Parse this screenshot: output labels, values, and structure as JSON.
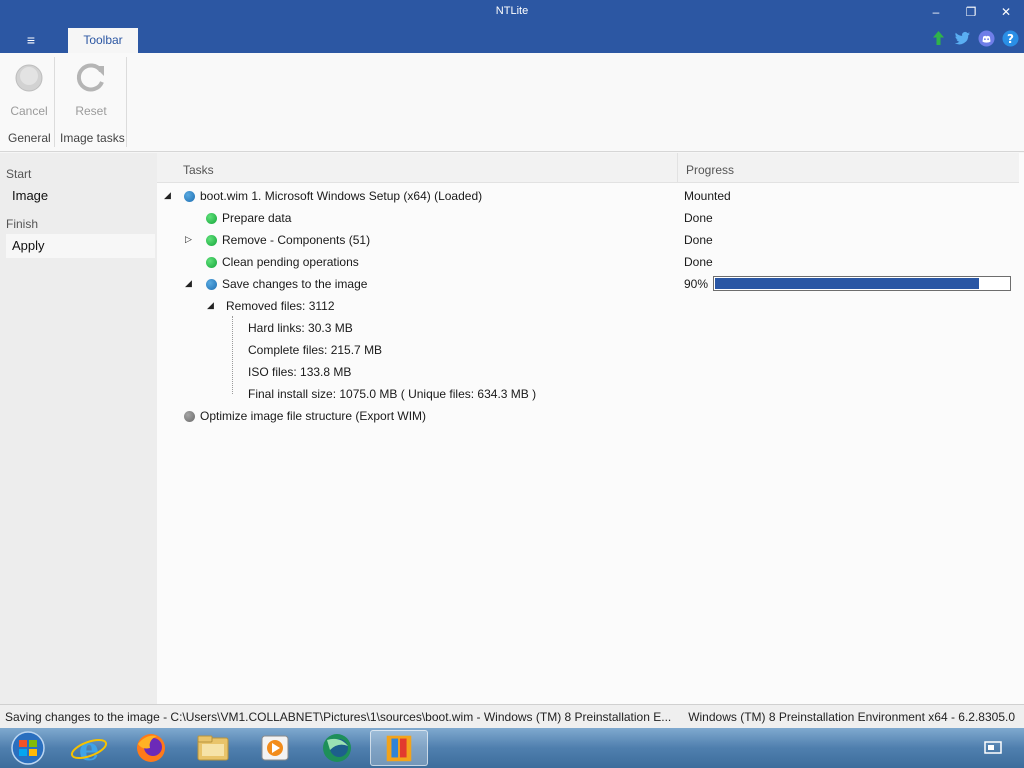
{
  "window": {
    "title": "NTLite",
    "minimize_glyph": "–",
    "restore_glyph": "❐",
    "close_glyph": "✕"
  },
  "menu": {
    "hamburger_glyph": "≡"
  },
  "ribbon": {
    "tab_label": "Toolbar",
    "buttons": {
      "cancel": "Cancel",
      "reset": "Reset"
    },
    "groups": {
      "general": "General",
      "image_tasks": "Image tasks"
    }
  },
  "social_icons": [
    "update-arrow-icon",
    "twitter-icon",
    "discord-icon",
    "help-icon"
  ],
  "nav": {
    "start_header": "Start",
    "image_item": "Image",
    "finish_header": "Finish",
    "apply_item": "Apply"
  },
  "columns": {
    "tasks": "Tasks",
    "progress": "Progress"
  },
  "tasks": {
    "image": {
      "label": "boot.wim 1. Microsoft Windows Setup (x64)  (Loaded)",
      "status": "Mounted"
    },
    "prepare": {
      "label": "Prepare data",
      "status": "Done"
    },
    "remove": {
      "label": "Remove - Components (51)",
      "status": "Done"
    },
    "clean": {
      "label": "Clean pending operations",
      "status": "Done"
    },
    "save": {
      "label": "Save changes to the image",
      "percent_text": "90%",
      "progress": 0.9
    },
    "removed_files": "Removed files: 3112",
    "hard_links": "Hard links: 30.3 MB",
    "complete_files": "Complete files: 215.7 MB",
    "iso_files": "ISO files: 133.8 MB",
    "final_size": "Final install size: 1075.0 MB ( Unique files: 634.3 MB )",
    "optimize": "Optimize image file structure (Export WIM)"
  },
  "status": {
    "left": "Saving changes to the image - C:\\Users\\VM1.COLLABNET\\Pictures\\1\\sources\\boot.wim - Windows (TM) 8 Preinstallation E...",
    "right": "Windows (TM) 8 Preinstallation Environment x64 - 6.2.8305.0"
  },
  "taskbar_icons": [
    "start-orb-icon",
    "internet-explorer-icon",
    "firefox-icon",
    "file-explorer-icon",
    "media-player-icon",
    "app-icon",
    "ntlite-icon"
  ],
  "colors": {
    "accent": "#2c57a3",
    "progress_fill": "#2956a4",
    "green": "#15a63a",
    "blue": "#1f6fb2"
  }
}
